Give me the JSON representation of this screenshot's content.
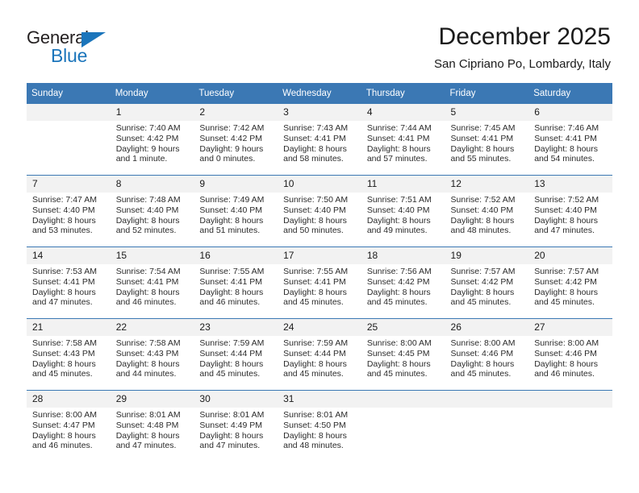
{
  "brand": {
    "name_top": "General",
    "name_bottom": "Blue",
    "color_primary": "#1b75bb",
    "color_text": "#231f20",
    "triangle_icon": "triangle-icon"
  },
  "header": {
    "month_title": "December 2025",
    "location": "San Cipriano Po, Lombardy, Italy"
  },
  "theme": {
    "header_row_bg": "#3b78b4",
    "daynum_bg": "#f2f2f2",
    "grid_line": "#3b78b4",
    "text": "#1a1a1a"
  },
  "weekdays": [
    "Sunday",
    "Monday",
    "Tuesday",
    "Wednesday",
    "Thursday",
    "Friday",
    "Saturday"
  ],
  "weeks": [
    [
      {
        "day": "",
        "sunrise": "",
        "sunset": "",
        "daylight_1": "",
        "daylight_2": ""
      },
      {
        "day": "1",
        "sunrise": "Sunrise: 7:40 AM",
        "sunset": "Sunset: 4:42 PM",
        "daylight_1": "Daylight: 9 hours",
        "daylight_2": "and 1 minute."
      },
      {
        "day": "2",
        "sunrise": "Sunrise: 7:42 AM",
        "sunset": "Sunset: 4:42 PM",
        "daylight_1": "Daylight: 9 hours",
        "daylight_2": "and 0 minutes."
      },
      {
        "day": "3",
        "sunrise": "Sunrise: 7:43 AM",
        "sunset": "Sunset: 4:41 PM",
        "daylight_1": "Daylight: 8 hours",
        "daylight_2": "and 58 minutes."
      },
      {
        "day": "4",
        "sunrise": "Sunrise: 7:44 AM",
        "sunset": "Sunset: 4:41 PM",
        "daylight_1": "Daylight: 8 hours",
        "daylight_2": "and 57 minutes."
      },
      {
        "day": "5",
        "sunrise": "Sunrise: 7:45 AM",
        "sunset": "Sunset: 4:41 PM",
        "daylight_1": "Daylight: 8 hours",
        "daylight_2": "and 55 minutes."
      },
      {
        "day": "6",
        "sunrise": "Sunrise: 7:46 AM",
        "sunset": "Sunset: 4:41 PM",
        "daylight_1": "Daylight: 8 hours",
        "daylight_2": "and 54 minutes."
      }
    ],
    [
      {
        "day": "7",
        "sunrise": "Sunrise: 7:47 AM",
        "sunset": "Sunset: 4:40 PM",
        "daylight_1": "Daylight: 8 hours",
        "daylight_2": "and 53 minutes."
      },
      {
        "day": "8",
        "sunrise": "Sunrise: 7:48 AM",
        "sunset": "Sunset: 4:40 PM",
        "daylight_1": "Daylight: 8 hours",
        "daylight_2": "and 52 minutes."
      },
      {
        "day": "9",
        "sunrise": "Sunrise: 7:49 AM",
        "sunset": "Sunset: 4:40 PM",
        "daylight_1": "Daylight: 8 hours",
        "daylight_2": "and 51 minutes."
      },
      {
        "day": "10",
        "sunrise": "Sunrise: 7:50 AM",
        "sunset": "Sunset: 4:40 PM",
        "daylight_1": "Daylight: 8 hours",
        "daylight_2": "and 50 minutes."
      },
      {
        "day": "11",
        "sunrise": "Sunrise: 7:51 AM",
        "sunset": "Sunset: 4:40 PM",
        "daylight_1": "Daylight: 8 hours",
        "daylight_2": "and 49 minutes."
      },
      {
        "day": "12",
        "sunrise": "Sunrise: 7:52 AM",
        "sunset": "Sunset: 4:40 PM",
        "daylight_1": "Daylight: 8 hours",
        "daylight_2": "and 48 minutes."
      },
      {
        "day": "13",
        "sunrise": "Sunrise: 7:52 AM",
        "sunset": "Sunset: 4:40 PM",
        "daylight_1": "Daylight: 8 hours",
        "daylight_2": "and 47 minutes."
      }
    ],
    [
      {
        "day": "14",
        "sunrise": "Sunrise: 7:53 AM",
        "sunset": "Sunset: 4:41 PM",
        "daylight_1": "Daylight: 8 hours",
        "daylight_2": "and 47 minutes."
      },
      {
        "day": "15",
        "sunrise": "Sunrise: 7:54 AM",
        "sunset": "Sunset: 4:41 PM",
        "daylight_1": "Daylight: 8 hours",
        "daylight_2": "and 46 minutes."
      },
      {
        "day": "16",
        "sunrise": "Sunrise: 7:55 AM",
        "sunset": "Sunset: 4:41 PM",
        "daylight_1": "Daylight: 8 hours",
        "daylight_2": "and 46 minutes."
      },
      {
        "day": "17",
        "sunrise": "Sunrise: 7:55 AM",
        "sunset": "Sunset: 4:41 PM",
        "daylight_1": "Daylight: 8 hours",
        "daylight_2": "and 45 minutes."
      },
      {
        "day": "18",
        "sunrise": "Sunrise: 7:56 AM",
        "sunset": "Sunset: 4:42 PM",
        "daylight_1": "Daylight: 8 hours",
        "daylight_2": "and 45 minutes."
      },
      {
        "day": "19",
        "sunrise": "Sunrise: 7:57 AM",
        "sunset": "Sunset: 4:42 PM",
        "daylight_1": "Daylight: 8 hours",
        "daylight_2": "and 45 minutes."
      },
      {
        "day": "20",
        "sunrise": "Sunrise: 7:57 AM",
        "sunset": "Sunset: 4:42 PM",
        "daylight_1": "Daylight: 8 hours",
        "daylight_2": "and 45 minutes."
      }
    ],
    [
      {
        "day": "21",
        "sunrise": "Sunrise: 7:58 AM",
        "sunset": "Sunset: 4:43 PM",
        "daylight_1": "Daylight: 8 hours",
        "daylight_2": "and 45 minutes."
      },
      {
        "day": "22",
        "sunrise": "Sunrise: 7:58 AM",
        "sunset": "Sunset: 4:43 PM",
        "daylight_1": "Daylight: 8 hours",
        "daylight_2": "and 44 minutes."
      },
      {
        "day": "23",
        "sunrise": "Sunrise: 7:59 AM",
        "sunset": "Sunset: 4:44 PM",
        "daylight_1": "Daylight: 8 hours",
        "daylight_2": "and 45 minutes."
      },
      {
        "day": "24",
        "sunrise": "Sunrise: 7:59 AM",
        "sunset": "Sunset: 4:44 PM",
        "daylight_1": "Daylight: 8 hours",
        "daylight_2": "and 45 minutes."
      },
      {
        "day": "25",
        "sunrise": "Sunrise: 8:00 AM",
        "sunset": "Sunset: 4:45 PM",
        "daylight_1": "Daylight: 8 hours",
        "daylight_2": "and 45 minutes."
      },
      {
        "day": "26",
        "sunrise": "Sunrise: 8:00 AM",
        "sunset": "Sunset: 4:46 PM",
        "daylight_1": "Daylight: 8 hours",
        "daylight_2": "and 45 minutes."
      },
      {
        "day": "27",
        "sunrise": "Sunrise: 8:00 AM",
        "sunset": "Sunset: 4:46 PM",
        "daylight_1": "Daylight: 8 hours",
        "daylight_2": "and 46 minutes."
      }
    ],
    [
      {
        "day": "28",
        "sunrise": "Sunrise: 8:00 AM",
        "sunset": "Sunset: 4:47 PM",
        "daylight_1": "Daylight: 8 hours",
        "daylight_2": "and 46 minutes."
      },
      {
        "day": "29",
        "sunrise": "Sunrise: 8:01 AM",
        "sunset": "Sunset: 4:48 PM",
        "daylight_1": "Daylight: 8 hours",
        "daylight_2": "and 47 minutes."
      },
      {
        "day": "30",
        "sunrise": "Sunrise: 8:01 AM",
        "sunset": "Sunset: 4:49 PM",
        "daylight_1": "Daylight: 8 hours",
        "daylight_2": "and 47 minutes."
      },
      {
        "day": "31",
        "sunrise": "Sunrise: 8:01 AM",
        "sunset": "Sunset: 4:50 PM",
        "daylight_1": "Daylight: 8 hours",
        "daylight_2": "and 48 minutes."
      },
      {
        "day": "",
        "sunrise": "",
        "sunset": "",
        "daylight_1": "",
        "daylight_2": ""
      },
      {
        "day": "",
        "sunrise": "",
        "sunset": "",
        "daylight_1": "",
        "daylight_2": ""
      },
      {
        "day": "",
        "sunrise": "",
        "sunset": "",
        "daylight_1": "",
        "daylight_2": ""
      }
    ]
  ]
}
